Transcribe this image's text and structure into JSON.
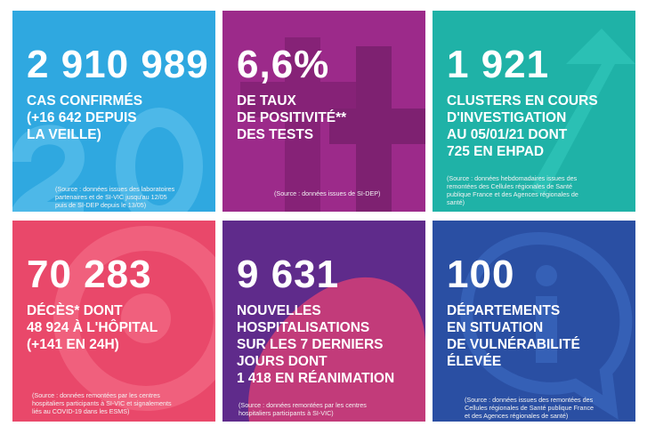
{
  "tiles": [
    {
      "number": "2 910 989",
      "label_lines": [
        "CAS CONFIRMÉS",
        "(+16 642 DEPUIS",
        "LA VEILLE)"
      ],
      "source_lines": [
        "(Source : données issues des laboratoires",
        "partenaires et de SI-VIC jusqu'au 12/05",
        "puis de SI-DEP depuis le 13/05)"
      ],
      "color": "#2fa8e0"
    },
    {
      "number": "6,6%",
      "label_lines": [
        "DE TAUX",
        "DE POSITIVITÉ**",
        "DES TESTS"
      ],
      "source_lines": [
        "(Source : données issues de SI-DEP)"
      ],
      "color": "#9c2a8a"
    },
    {
      "number": "1 921",
      "label_lines": [
        "CLUSTERS EN COURS",
        "D'INVESTIGATION",
        "AU 05/01/21 DONT",
        "725 EN EHPAD"
      ],
      "source_lines": [
        "(Source : données hebdomadaires issues des",
        "remontées des Cellules régionales de Santé",
        "publique France et des Agences régionales de",
        "santé)"
      ],
      "color": "#1fb2a7"
    },
    {
      "number": "70 283",
      "label_lines": [
        "DÉCÈS* DONT",
        "48 924 À L'HÔPITAL",
        "(+141 EN 24H)"
      ],
      "source_lines": [
        "(Source : données remontées par les centres",
        "hospitaliers participants à SI-VIC et signalements",
        "liés au COVID-19 dans les ESMS)"
      ],
      "color": "#e9486a"
    },
    {
      "number": "9 631",
      "label_lines": [
        "NOUVELLES",
        "HOSPITALISATIONS",
        "SUR LES 7 DERNIERS",
        "JOURS DONT",
        "1 418 EN RÉANIMATION"
      ],
      "source_lines": [
        "(Source : données remontées par les centres",
        "hospitaliers participants à SI-VIC)"
      ],
      "color": "#5f2b8b"
    },
    {
      "number": "100",
      "label_lines": [
        "DÉPARTEMENTS",
        "EN SITUATION",
        "DE VULNÉRABILITÉ",
        "ÉLEVÉE"
      ],
      "source_lines": [
        "(Source : données issues des remontées des",
        "Cellules régionales de Santé publique France",
        "et des Agences régionales de santé)"
      ],
      "color": "#2a4fa3"
    }
  ]
}
